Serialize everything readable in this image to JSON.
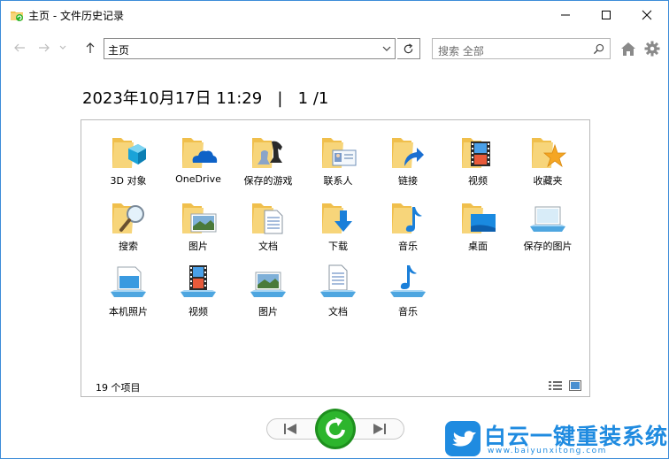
{
  "window": {
    "title": "主页 - 文件历史记录"
  },
  "nav": {
    "address": "主页",
    "search_placeholder": "搜索 全部"
  },
  "snapshot": {
    "date": "2023年10月17日 11:29",
    "separator": "|",
    "page": "1 /1"
  },
  "items": [
    {
      "label": "3D 对象",
      "icon": "folder-3d-objects-icon"
    },
    {
      "label": "OneDrive",
      "icon": "folder-onedrive-icon"
    },
    {
      "label": "保存的游戏",
      "icon": "folder-saved-games-icon"
    },
    {
      "label": "联系人",
      "icon": "folder-contacts-icon"
    },
    {
      "label": "链接",
      "icon": "folder-links-icon"
    },
    {
      "label": "视频",
      "icon": "folder-videos-icon"
    },
    {
      "label": "收藏夹",
      "icon": "folder-favorites-icon"
    },
    {
      "label": "搜索",
      "icon": "folder-searches-icon"
    },
    {
      "label": "图片",
      "icon": "folder-pictures-icon"
    },
    {
      "label": "文档",
      "icon": "folder-documents-icon"
    },
    {
      "label": "下载",
      "icon": "folder-downloads-icon"
    },
    {
      "label": "音乐",
      "icon": "folder-music-icon"
    },
    {
      "label": "桌面",
      "icon": "folder-desktop-icon"
    },
    {
      "label": "保存的图片",
      "icon": "library-saved-pictures-icon"
    },
    {
      "label": "本机照片",
      "icon": "library-camera-roll-icon"
    },
    {
      "label": "视频",
      "icon": "library-videos-icon"
    },
    {
      "label": "图片",
      "icon": "library-pictures-icon"
    },
    {
      "label": "文档",
      "icon": "library-documents-icon"
    },
    {
      "label": "音乐",
      "icon": "library-music-icon"
    }
  ],
  "status": {
    "count": "19 个项目"
  },
  "watermark": {
    "brand": "白云一键重装系统",
    "url": "www.baiyunxitong.com"
  },
  "colors": {
    "accent": "#0078d7",
    "folder": "#f5c85a",
    "restore_green": "#2db52d",
    "watermark_blue": "#1f8be0"
  }
}
